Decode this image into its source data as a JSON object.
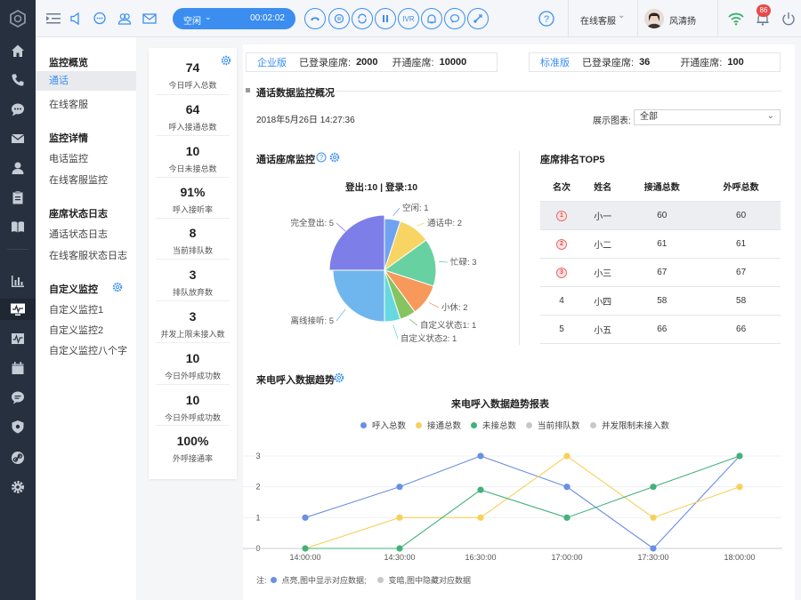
{
  "topbar": {
    "call_status": "空闲",
    "call_timer": "00:02:02",
    "call_buttons": [
      "hangup-icon",
      "hold-icon",
      "transfer-icon",
      "pause-icon",
      "IVR",
      "consult-icon",
      "chat-icon",
      "dial-icon"
    ],
    "ivr_label": "IVR",
    "service_mode": "在线客服",
    "user_name": "风清扬",
    "notification_count": "86"
  },
  "sidebar": {
    "groups": [
      {
        "title": "监控概览",
        "items": [
          "通话",
          "在线客服"
        ]
      },
      {
        "title": "监控详情",
        "items": [
          "电话监控",
          "在线客服监控"
        ]
      },
      {
        "title": "座席状态日志",
        "items": [
          "通话状态日志",
          "在线客服状态日志"
        ]
      },
      {
        "title": "自定义监控",
        "items": [
          "自定义监控1",
          "自定义监控2",
          "自定义监控八个字"
        ]
      }
    ]
  },
  "stats": [
    {
      "value": "74",
      "label": "今日呼入总数"
    },
    {
      "value": "64",
      "label": "呼入接通总数"
    },
    {
      "value": "10",
      "label": "今日未接总数"
    },
    {
      "value": "91%",
      "label": "呼入接听率"
    },
    {
      "value": "8",
      "label": "当前排队数"
    },
    {
      "value": "3",
      "label": "排队放弃数"
    },
    {
      "value": "3",
      "label": "并发上限未接入数"
    },
    {
      "value": "10",
      "label": "今日外呼成功数"
    },
    {
      "value": "10",
      "label": "今日外呼成功数"
    },
    {
      "value": "100%",
      "label": "外呼接通率"
    }
  ],
  "seats": {
    "enterprise": {
      "edition": "企业版",
      "logged_label": "已登录座席:",
      "logged": "2000",
      "open_label": "开通座席:",
      "open": "10000"
    },
    "standard": {
      "edition": "标准版",
      "logged_label": "已登录座席:",
      "logged": "36",
      "open_label": "开通座席:",
      "open": "100"
    }
  },
  "overview": {
    "title": "通话数据监控概况",
    "datetime": "2018年5月26日 14:27:36",
    "chart_select_label": "展示图表:",
    "chart_select_value": "全部"
  },
  "seat_monitor": {
    "title": "通话座席监控",
    "summary": "登出:10 | 登录:10"
  },
  "rank": {
    "title": "座席排名TOP5",
    "headers": [
      "名次",
      "姓名",
      "接通总数",
      "外呼总数"
    ],
    "rows": [
      {
        "rank": "1",
        "name": "小一",
        "connected": "60",
        "outbound": "60"
      },
      {
        "rank": "2",
        "name": "小二",
        "connected": "61",
        "outbound": "61"
      },
      {
        "rank": "3",
        "name": "小三",
        "connected": "67",
        "outbound": "67"
      },
      {
        "rank": "4",
        "name": "小四",
        "connected": "58",
        "outbound": "58"
      },
      {
        "rank": "5",
        "name": "小五",
        "connected": "66",
        "outbound": "66"
      }
    ]
  },
  "trend": {
    "section_title": "来电呼入数据趋势",
    "note_prefix": "注:",
    "note_on": "点亮,图中显示对应数据;",
    "note_off": "变暗,图中隐藏对应数据"
  },
  "colors": {
    "accent": "#3b8ef0",
    "rail": "#27303f",
    "blue": "#6a8fe3",
    "yellow": "#f5d15c",
    "green": "#43b17b",
    "grey": "#c8c8c8"
  },
  "chart_data": [
    {
      "type": "pie",
      "title": "登出:10 | 登录:10",
      "slices": [
        {
          "label": "空闲",
          "value": 1,
          "color": "#6fa2f1"
        },
        {
          "label": "通话中",
          "value": 2,
          "color": "#f8d463"
        },
        {
          "label": "忙碌",
          "value": 3,
          "color": "#67d1a1"
        },
        {
          "label": "小休",
          "value": 2,
          "color": "#f6995b"
        },
        {
          "label": "自定义状态1",
          "value": 1,
          "color": "#85c460"
        },
        {
          "label": "自定义状态2",
          "value": 1,
          "color": "#66d8e0"
        },
        {
          "label": "离线接听",
          "value": 5,
          "color": "#6fb6ee"
        },
        {
          "label": "完全登出",
          "value": 5,
          "color": "#7e7ee8"
        }
      ],
      "slice_texts": [
        "空闲: 1",
        "通话中: 2",
        "忙碌: 3",
        "小休: 2",
        "自定义状态1: 1",
        "自定义状态2: 1",
        "离线接听: 5",
        "完全登出: 5"
      ]
    },
    {
      "type": "line",
      "title": "来电呼入数据趋势报表",
      "x": [
        "14:00:00",
        "14:30:00",
        "16:30:00",
        "17:00:00",
        "17:30:00",
        "18:00:00"
      ],
      "ylim": [
        0,
        3
      ],
      "yticks": [
        "0",
        "1",
        "2",
        "3"
      ],
      "series": [
        {
          "name": "呼入总数",
          "color": "#6a8fe3",
          "values": [
            1,
            2,
            3,
            2,
            0,
            3
          ]
        },
        {
          "name": "接通总数",
          "color": "#f5d15c",
          "values": [
            0,
            1,
            1,
            3,
            1,
            2
          ]
        },
        {
          "name": "未接总数",
          "color": "#43b17b",
          "values": [
            0,
            0,
            1.9,
            1,
            2,
            3
          ]
        },
        {
          "name": "当前排队数",
          "color": "#c8c8c8",
          "values": []
        },
        {
          "name": "并发限制未接入数",
          "color": "#c8c8c8",
          "values": []
        }
      ]
    }
  ]
}
